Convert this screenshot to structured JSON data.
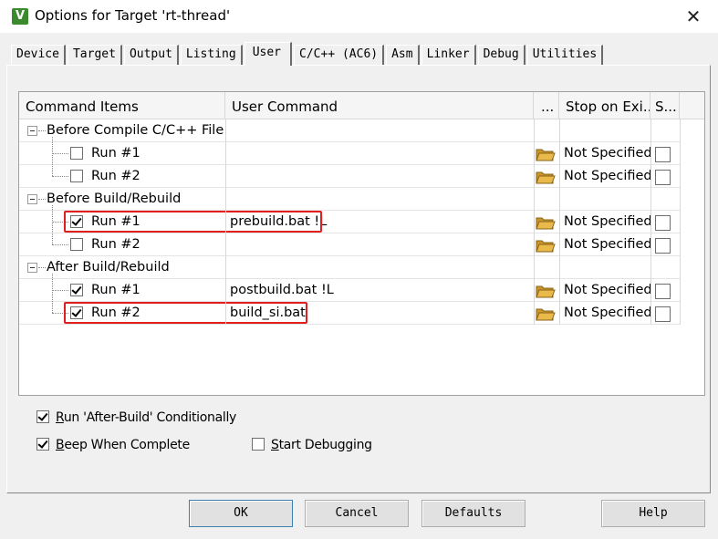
{
  "window": {
    "title": "Options for Target 'rt-thread'",
    "icon_letter": "V",
    "close_glyph": "✕"
  },
  "tabs": [
    {
      "label": "Device",
      "active": false
    },
    {
      "label": "Target",
      "active": false
    },
    {
      "label": "Output",
      "active": false
    },
    {
      "label": "Listing",
      "active": false
    },
    {
      "label": "User",
      "active": true
    },
    {
      "label": "C/C++ (AC6)",
      "active": false
    },
    {
      "label": "Asm",
      "active": false
    },
    {
      "label": "Linker",
      "active": false
    },
    {
      "label": "Debug",
      "active": false
    },
    {
      "label": "Utilities",
      "active": false
    }
  ],
  "grid": {
    "headers": {
      "command_items": "Command Items",
      "user_command": "User Command",
      "browse": "...",
      "stop_on_exit": "Stop on Exi...",
      "s": "S..."
    },
    "groups": [
      {
        "label": "Before Compile C/C++ File",
        "runs": [
          {
            "label": "Run #1",
            "checked": false,
            "command": "",
            "stop": "Not Specified",
            "s_checked": false,
            "highlighted": false
          },
          {
            "label": "Run #2",
            "checked": false,
            "command": "",
            "stop": "Not Specified",
            "s_checked": false,
            "highlighted": false
          }
        ]
      },
      {
        "label": "Before Build/Rebuild",
        "runs": [
          {
            "label": "Run #1",
            "checked": true,
            "command": "prebuild.bat !L",
            "stop": "Not Specified",
            "s_checked": false,
            "highlighted": true
          },
          {
            "label": "Run #2",
            "checked": false,
            "command": "",
            "stop": "Not Specified",
            "s_checked": false,
            "highlighted": false
          }
        ]
      },
      {
        "label": "After Build/Rebuild",
        "runs": [
          {
            "label": "Run #1",
            "checked": true,
            "command": "postbuild.bat !L",
            "stop": "Not Specified",
            "s_checked": false,
            "highlighted": false
          },
          {
            "label": "Run #2",
            "checked": true,
            "command": "build_si.bat",
            "stop": "Not Specified",
            "s_checked": false,
            "highlighted": true
          }
        ]
      }
    ]
  },
  "options": {
    "run_after_build": {
      "prefix": "R",
      "rest": "un 'After-Build' Conditionally",
      "checked": true
    },
    "beep_when_complete": {
      "prefix": "B",
      "rest": "eep When Complete",
      "checked": true
    },
    "start_debugging": {
      "prefix": "S",
      "rest": "tart Debugging",
      "checked": false
    }
  },
  "buttons": {
    "ok": "OK",
    "cancel": "Cancel",
    "defaults": "Defaults",
    "help": "Help"
  },
  "colors": {
    "highlight": "#e02020",
    "folder": "#e9b949"
  },
  "icons": {
    "browse": "folder-open-icon",
    "app": "keil-app-icon",
    "close": "close-icon"
  }
}
